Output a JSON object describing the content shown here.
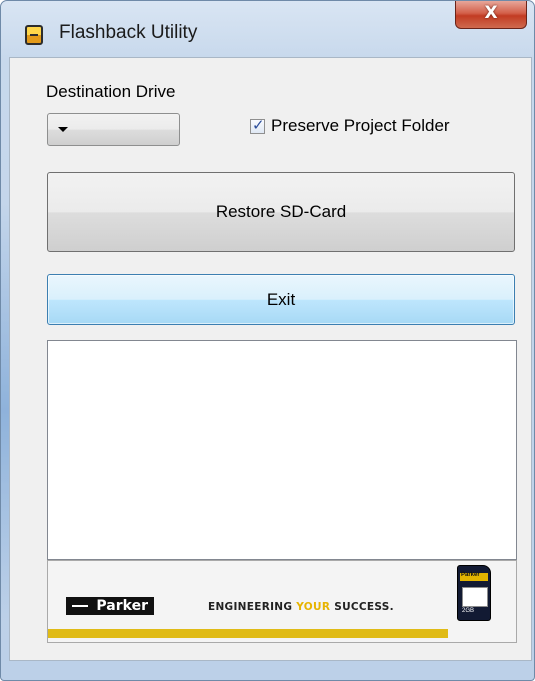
{
  "window": {
    "title": "Flashback Utility",
    "close_glyph": "X",
    "icon": "sd-card-app-icon"
  },
  "form": {
    "destination_label": "Destination Drive",
    "destination_value": "",
    "preserve_label": "Preserve Project Folder",
    "preserve_checked": true,
    "restore_label": "Restore SD-Card",
    "exit_label": "Exit",
    "log_text": ""
  },
  "banner": {
    "brand": "Parker",
    "tagline_pre": "ENGINEERING ",
    "tagline_accent": "YOUR",
    "tagline_post": " SUCCESS.",
    "card_brand": "Parker",
    "card_capacity": "2GB"
  },
  "colors": {
    "accent_yellow": "#e0bb16",
    "close_red": "#c23c23",
    "focus_blue": "#3c7fb1"
  }
}
